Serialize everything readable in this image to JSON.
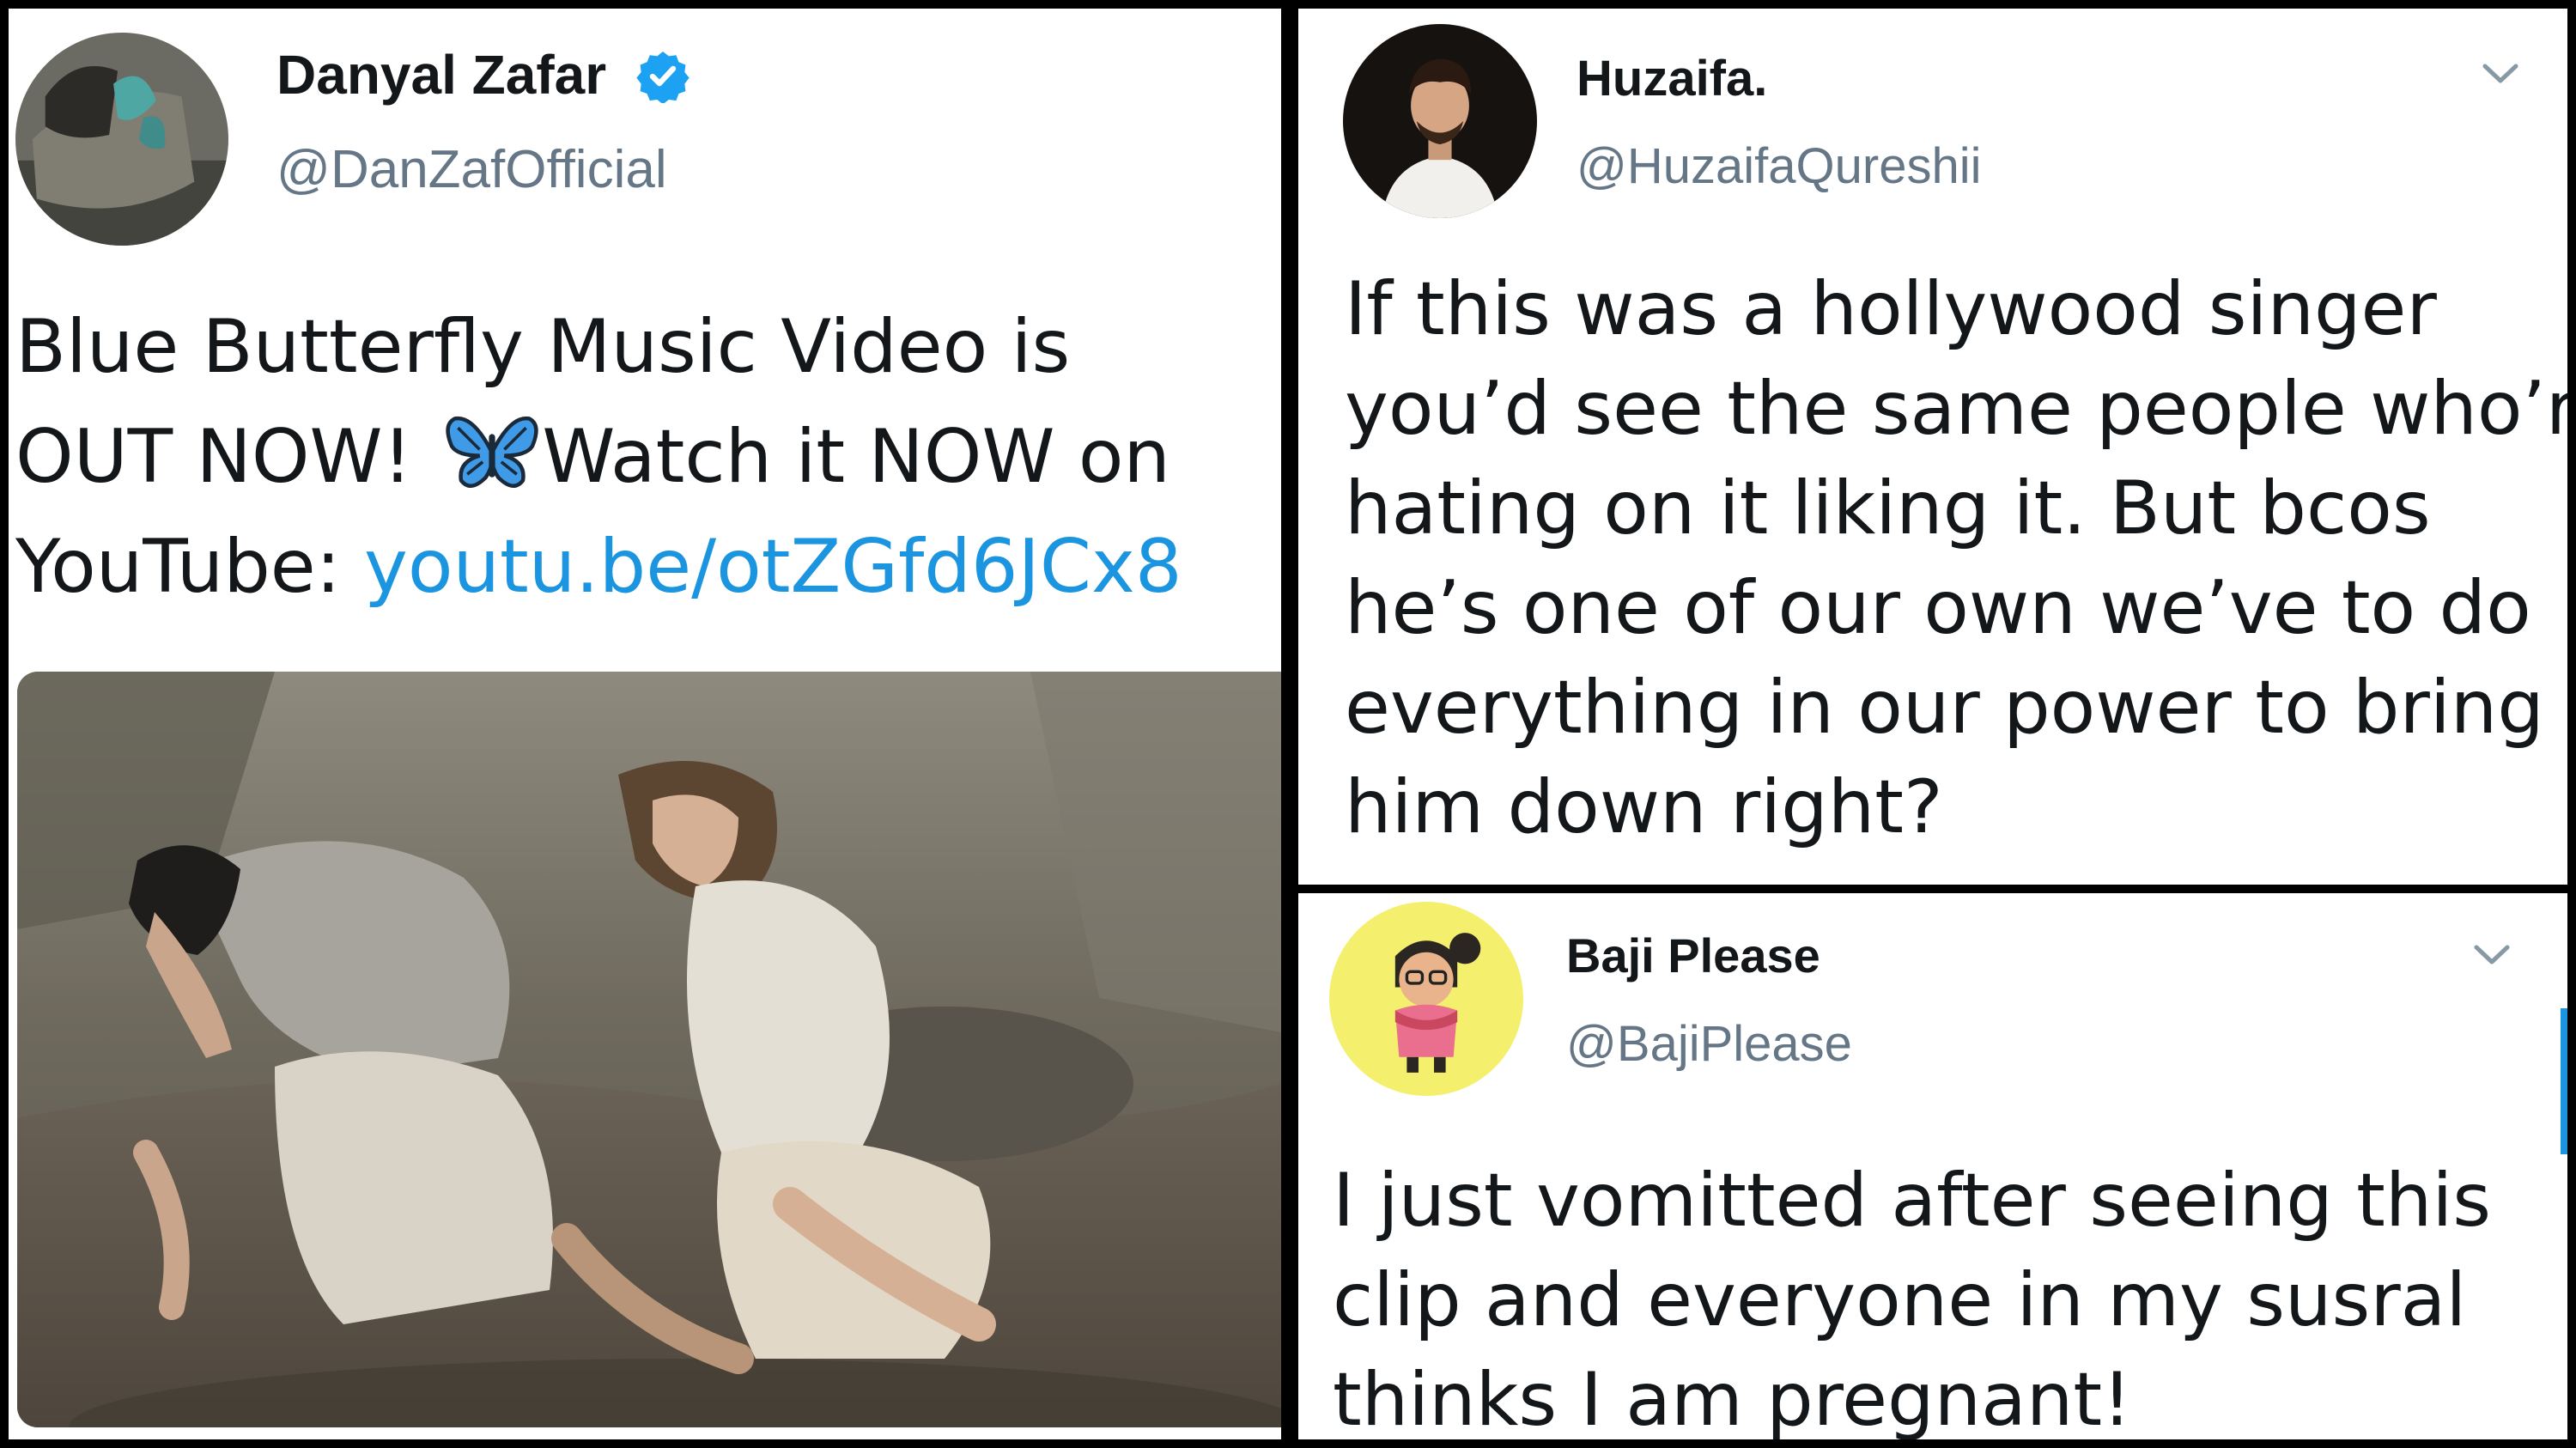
{
  "tweets": [
    {
      "display_name": "Danyal Zafar",
      "handle": "@DanZafOfficial",
      "verified": true,
      "lines": [
        {
          "text": "Blue Butterfly Music Video is"
        },
        {
          "pre": "OUT NOW! ",
          "emoji": "butterfly",
          "post": "Watch it NOW on"
        },
        {
          "text": "YouTube: ",
          "link": "youtu.be/otZGfd6JCx8"
        }
      ]
    },
    {
      "display_name": "Huzaifa.",
      "handle": "@HuzaifaQureshii",
      "lines": [
        "If this was a hollywood singer",
        "you’d see the same people who’re",
        "hating on it liking it. But bcos",
        "he’s one of our own we’ve to do",
        "everything in our power to bring",
        "him down right?"
      ]
    },
    {
      "display_name": "Baji Please",
      "handle": "@BajiPlease",
      "lines": [
        "I just vomitted after seeing this",
        "clip and everyone in my susral",
        "thinks I am pregnant!"
      ]
    }
  ],
  "colors": {
    "link": "#1b95e0",
    "handle": "#657786",
    "text": "#14171a",
    "verified_badge": "#1da1f2"
  },
  "icons": [
    "verified-badge-icon",
    "butterfly-emoji-icon",
    "chevron-down-icon"
  ]
}
